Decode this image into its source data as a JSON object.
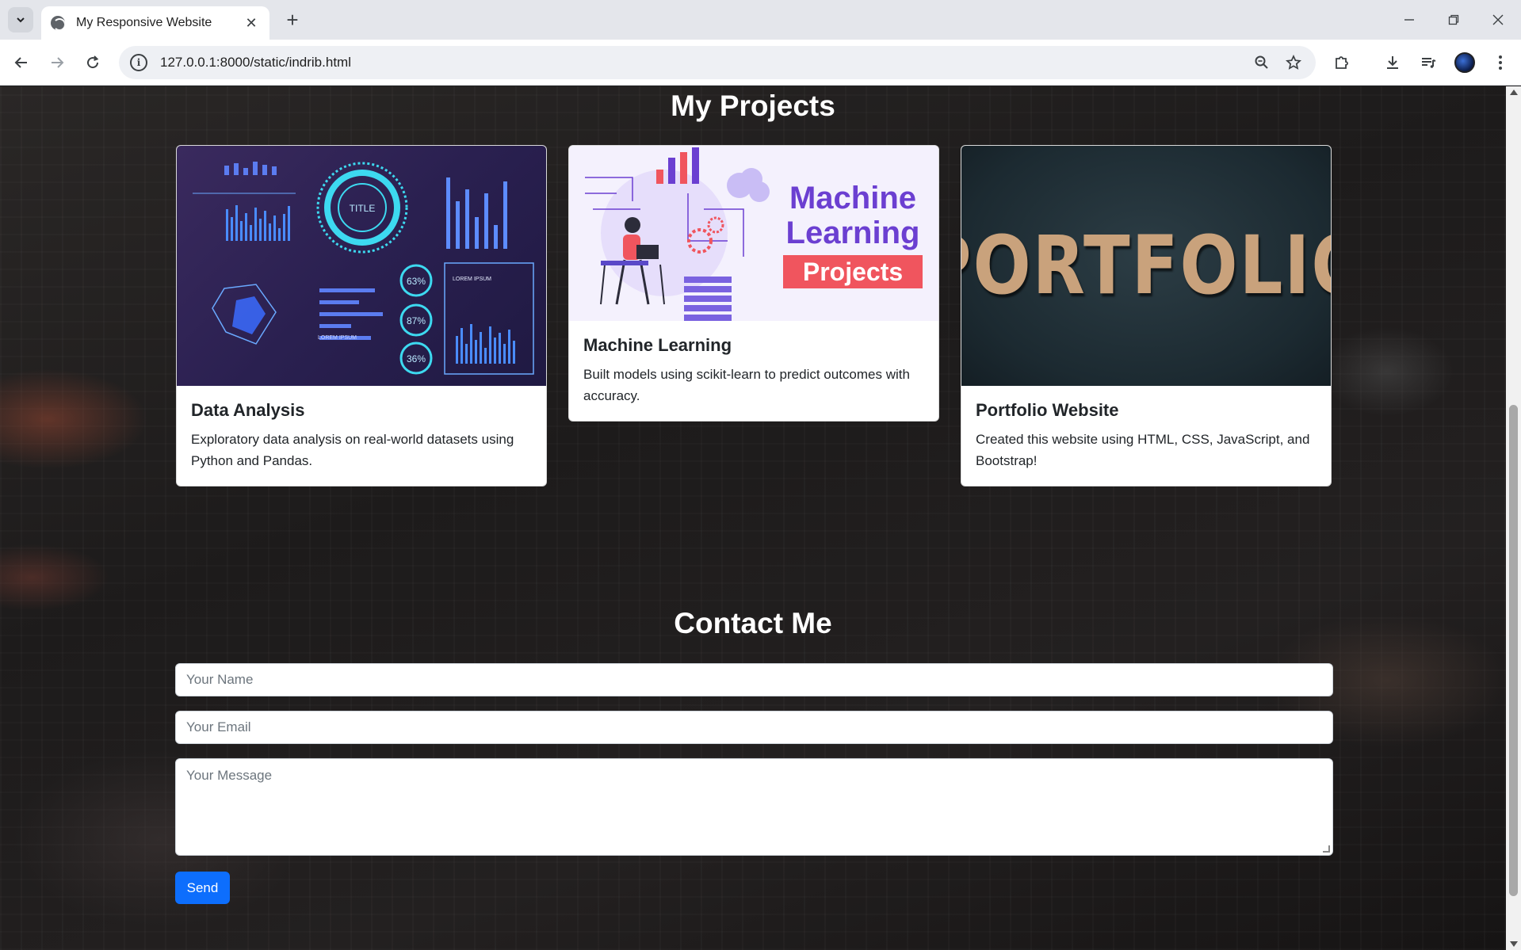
{
  "browser": {
    "tab_title": "My Responsive Website",
    "url": "127.0.0.1:8000/static/indrib.html",
    "new_tab_icon": "plus-icon"
  },
  "page": {
    "projects_heading": "My Projects",
    "projects": [
      {
        "title": "Data Analysis",
        "description": "Exploratory data analysis on real-world datasets using Python and Pandas.",
        "image_labels": [
          "TITLE",
          "63%",
          "87%",
          "36%",
          "LOREM IPSUM",
          "LOREM IPSUM"
        ]
      },
      {
        "title": "Machine Learning",
        "description": "Built models using scikit-learn to predict outcomes with accuracy.",
        "image_text": "Machine Learning",
        "image_badge": "Projects"
      },
      {
        "title": "Portfolio Website",
        "description": "Created this website using HTML, CSS, JavaScript, and Bootstrap!",
        "image_text": "PORTFOLIO"
      }
    ],
    "contact_heading": "Contact Me",
    "contact": {
      "name_placeholder": "Your Name",
      "email_placeholder": "Your Email",
      "message_placeholder": "Your Message",
      "send_label": "Send"
    }
  },
  "colors": {
    "primary_button": "#0d6efd",
    "ml_purple": "#6b3fd1",
    "ml_badge": "#f0555e"
  }
}
